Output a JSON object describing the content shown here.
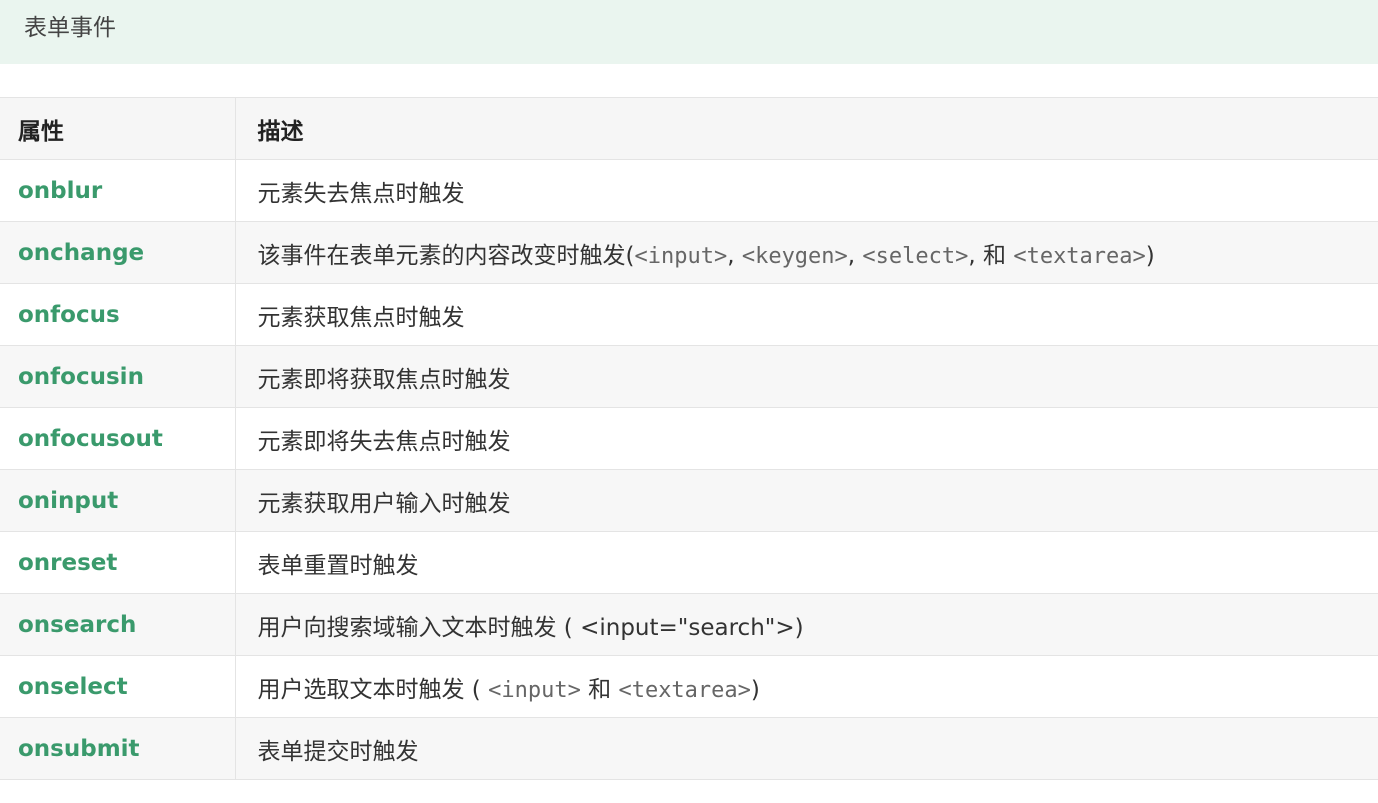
{
  "section": {
    "title": "表单事件"
  },
  "table": {
    "headers": {
      "attribute": "属性",
      "description": "描述"
    },
    "rows": [
      {
        "attribute": "onblur",
        "description": "元素失去焦点时触发"
      },
      {
        "attribute": "onchange",
        "description": "该事件在表单元素的内容改变时触发(",
        "codes": [
          "<input>",
          "<keygen>",
          "<select>",
          "<textarea>"
        ],
        "separators": [
          ", ",
          ", ",
          ", 和 "
        ],
        "suffix": ")"
      },
      {
        "attribute": "onfocus",
        "description": "元素获取焦点时触发"
      },
      {
        "attribute": "onfocusin",
        "description": "元素即将获取焦点时触发"
      },
      {
        "attribute": "onfocusout",
        "description": "元素即将失去焦点时触发"
      },
      {
        "attribute": "oninput",
        "description": "元素获取用户输入时触发"
      },
      {
        "attribute": "onreset",
        "description": "表单重置时触发"
      },
      {
        "attribute": "onsearch",
        "description": "用户向搜索域输入文本时触发 ( <input=\"search\">)"
      },
      {
        "attribute": "onselect",
        "description": "用户选取文本时触发 ( ",
        "codes": [
          "<input>",
          "<textarea>"
        ],
        "separators": [
          " 和 "
        ],
        "suffix": ")"
      },
      {
        "attribute": "onsubmit",
        "description": "表单提交时触发"
      }
    ]
  }
}
